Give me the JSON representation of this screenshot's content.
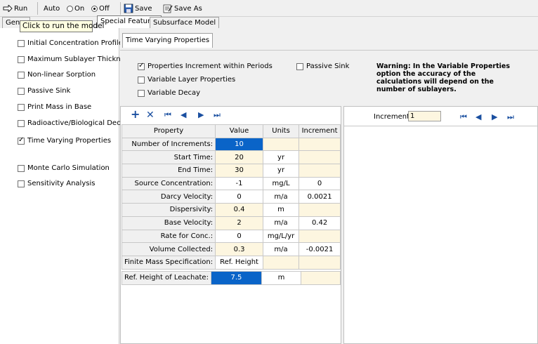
{
  "toolbar": {
    "run_label": "Run",
    "auto_label": "Auto",
    "on_label": "On",
    "off_label": "Off",
    "save_label": "Save",
    "save_as_label": "Save As"
  },
  "tooltip": "Click to run the model",
  "tabs": {
    "general": "Gene",
    "special_features": "Special Features",
    "subsurface_model": "Subsurface Model"
  },
  "left_options": [
    {
      "label": "Initial Concentration Profile",
      "checked": false
    },
    {
      "label": "Maximum Sublayer Thickness",
      "checked": false
    },
    {
      "label": "Non-linear Sorption",
      "checked": false
    },
    {
      "label": "Passive Sink",
      "checked": false
    },
    {
      "label": "Print Mass in Base",
      "checked": false
    },
    {
      "label": "Radioactive/Biological Decay",
      "checked": false
    },
    {
      "label": "Time Varying Properties",
      "checked": true
    },
    {
      "label": "Monte Carlo Simulation",
      "checked": false
    },
    {
      "label": "Sensitivity Analysis",
      "checked": false
    }
  ],
  "subtab": "Time Varying Properties",
  "options": {
    "increment_within_periods": "Properties Increment within Periods",
    "variable_layer": "Variable Layer Properties",
    "variable_decay": "Variable Decay",
    "passive_sink": "Passive Sink"
  },
  "warning": "Warning: In the Variable Properties option the accuracy of the calculations will depend on the number of sublayers.",
  "grid": {
    "headers": [
      "Property",
      "Value",
      "Units",
      "Increment"
    ],
    "rows": [
      {
        "property": "Number of Increments:",
        "value": "10",
        "units": "",
        "increment": ""
      },
      {
        "property": "Start Time:",
        "value": "20",
        "units": "yr",
        "increment": ""
      },
      {
        "property": "End Time:",
        "value": "30",
        "units": "yr",
        "increment": ""
      },
      {
        "property": "Source Concentration:",
        "value": "-1",
        "units": "mg/L",
        "increment": "0"
      },
      {
        "property": "Darcy Velocity:",
        "value": "0",
        "units": "m/a",
        "increment": "0.0021"
      },
      {
        "property": "Dispersivity:",
        "value": "0.4",
        "units": "m",
        "increment": ""
      },
      {
        "property": "Base Velocity:",
        "value": "2",
        "units": "m/a",
        "increment": "0.42"
      },
      {
        "property": "Rate for Conc.:",
        "value": "0",
        "units": "mg/L/yr",
        "increment": ""
      },
      {
        "property": "Volume Collected:",
        "value": "0.3",
        "units": "m/a",
        "increment": "-0.0021"
      },
      {
        "property": "Finite Mass Specification:",
        "value": "Ref. Height",
        "units": "",
        "increment": ""
      }
    ],
    "extra_row": {
      "property": "Ref. Height of Leachate:",
      "value": "7.5",
      "units": "m",
      "increment": ""
    }
  },
  "right_panel": {
    "increment_label": "Increment:",
    "increment_value": "1"
  }
}
